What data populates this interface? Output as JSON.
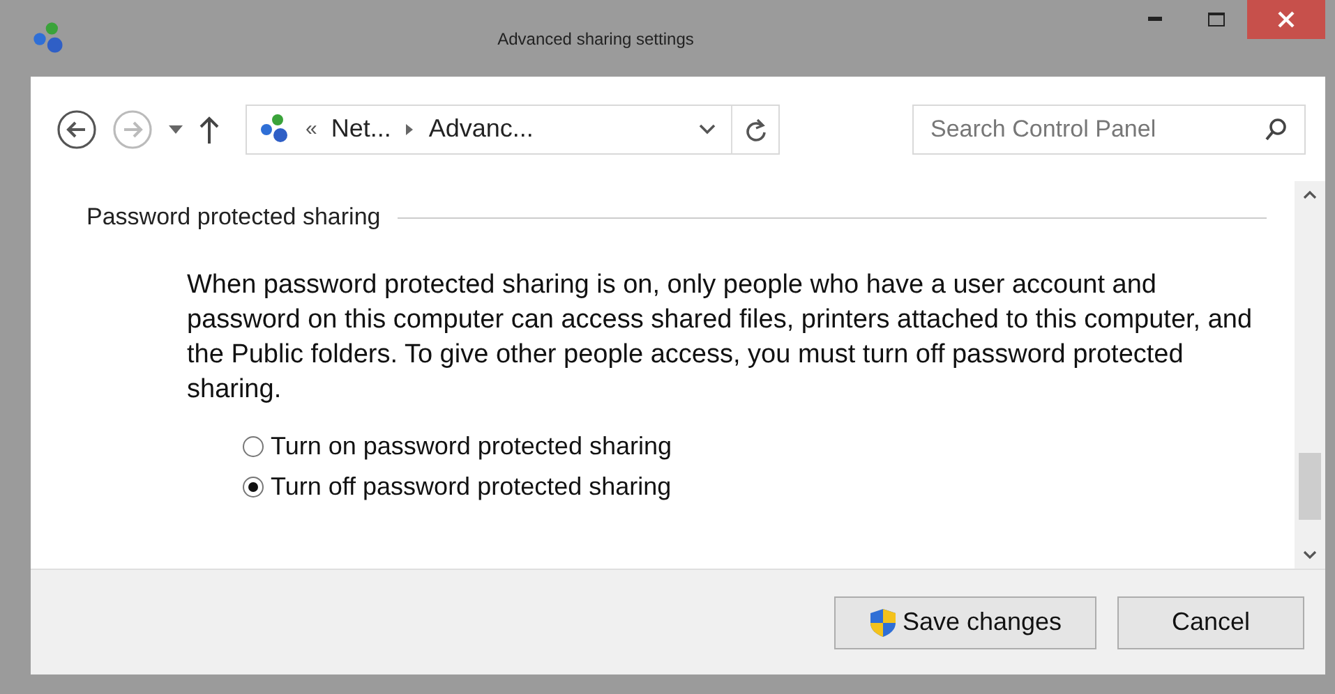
{
  "window": {
    "title": "Advanced sharing settings"
  },
  "navigation": {
    "breadcrumb_overflow": "«",
    "breadcrumb": [
      "Net...",
      "Advanc..."
    ],
    "search": {
      "placeholder": "Search Control Panel"
    }
  },
  "section": {
    "heading": "Password protected sharing",
    "description": "When password protected sharing is on, only people who have a user account and password on this computer can access shared files, printers attached to this computer, and the Public folders. To give other people access, you must turn off password protected sharing.",
    "options": [
      {
        "label": "Turn on password protected sharing",
        "selected": false
      },
      {
        "label": "Turn off password protected sharing",
        "selected": true
      }
    ]
  },
  "buttons": [
    {
      "label": "Save changes",
      "kind": "shield"
    },
    {
      "label": "Cancel",
      "kind": "plain"
    }
  ]
}
